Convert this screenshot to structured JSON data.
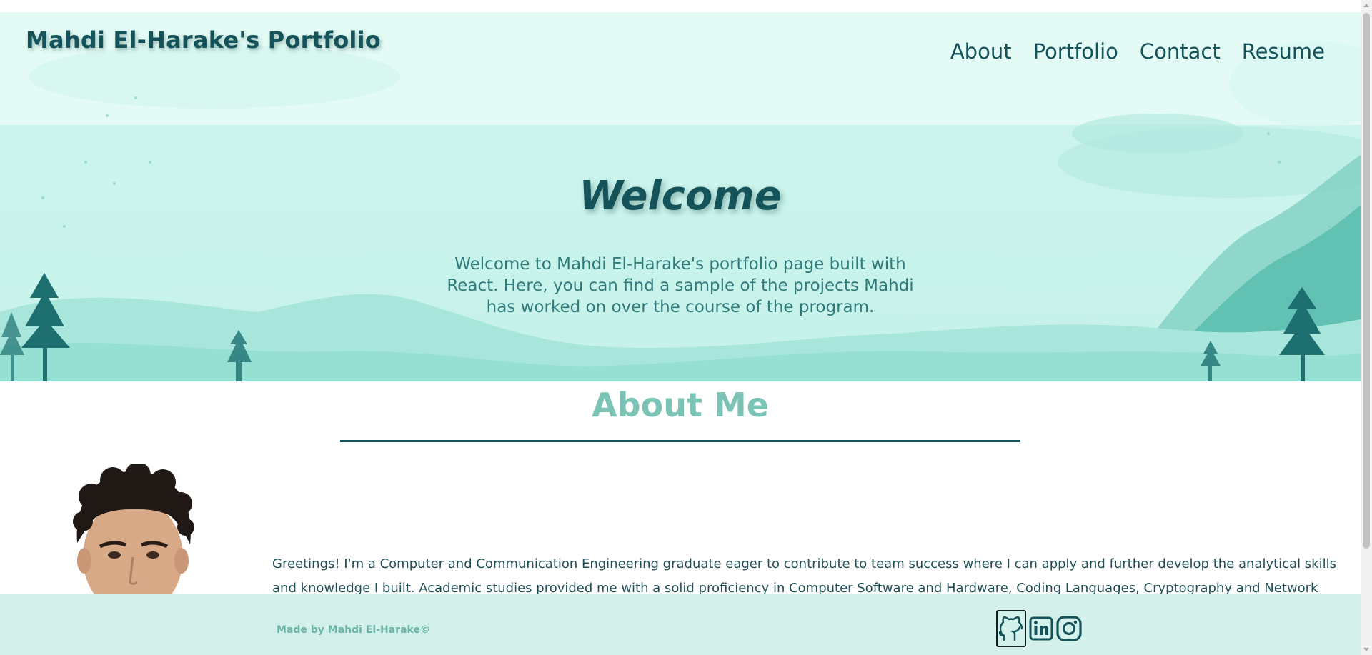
{
  "header": {
    "site_title": "Mahdi El-Harake's Portfolio",
    "nav": [
      "About",
      "Portfolio",
      "Contact",
      "Resume"
    ]
  },
  "hero": {
    "title": "Welcome",
    "text": "Welcome to Mahdi El-Harake's portfolio page built with React. Here, you can find a sample of the projects Mahdi has worked on over the course of the program."
  },
  "about": {
    "title": "About Me",
    "text": "Greetings! I'm a Computer and Communication Engineering graduate eager to contribute to team success where I can apply and further develop the analytical skills and knowledge I built. Academic studies provided me with a solid proficiency in Computer Software and Hardware, Coding Languages, Cryptography and Network Security. A"
  },
  "footer": {
    "credit": "Made by Mahdi El-Harake©",
    "icons": [
      "github-icon",
      "linkedin-icon",
      "instagram-icon"
    ]
  },
  "colors": {
    "primary": "#14535a",
    "accent": "#7bc4b5",
    "hero_bg": "#c6f2ea",
    "footer_bg": "#d3f0ea"
  }
}
